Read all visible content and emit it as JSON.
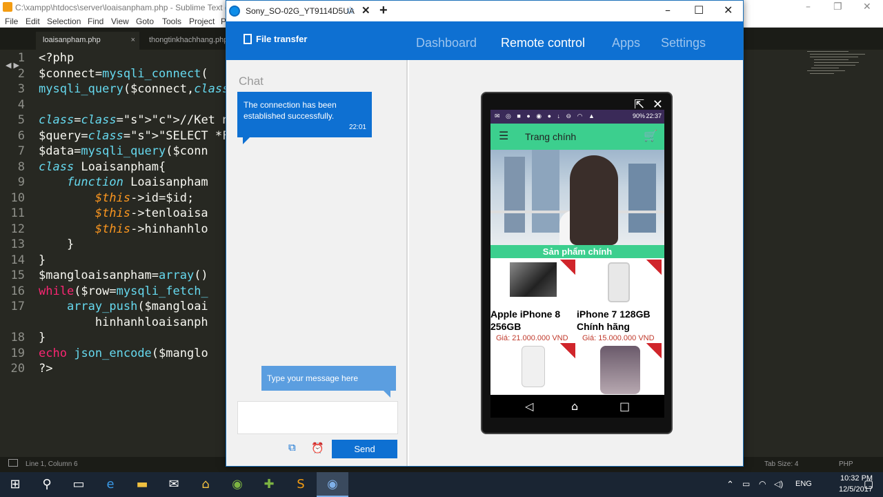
{
  "sublime": {
    "title": "C:\\xampp\\htdocs\\server\\loaisanpham.php - Sublime Text (UN",
    "menu": [
      "File",
      "Edit",
      "Selection",
      "Find",
      "View",
      "Goto",
      "Tools",
      "Project",
      "P"
    ],
    "tabs": [
      {
        "label": "loaisanpham.php",
        "close": "×"
      },
      {
        "label": "thongtinkhachhang.php"
      }
    ],
    "line_numbers": [
      "1",
      "2",
      "3",
      "4",
      "5",
      "6",
      "7",
      "8",
      "9",
      "10",
      "11",
      "12",
      "13",
      "14",
      "15",
      "16",
      "17",
      "",
      "18",
      "19",
      "20"
    ],
    "code": [
      "<?php",
      "$connect=mysqli_connect(",
      "mysqli_query($connect,\"S",
      "",
      "//Ket noi den bang du li",
      "$query=\"SELECT *FROM loa",
      "$data=mysqli_query($conn",
      "class Loaisanpham{",
      "    function Loaisanpham",
      "        $this->id=$id;",
      "        $this->tenloaisa",
      "        $this->hinhanhlo",
      "    }",
      "}",
      "$mangloaisanpham=array()",
      "while($row=mysqli_fetch_",
      "    array_push($mangloai",
      "        hinhanhloaisanph",
      "}",
      "echo json_encode($manglo",
      "?>"
    ],
    "status_left": "Line 1, Column 6",
    "status_tab": "Tab Size: 4",
    "status_syntax": "PHP"
  },
  "teamviewer": {
    "tab_title": "Sony_SO-02G_YT9114D5UA",
    "file_transfer": "File transfer",
    "nav": [
      "Dashboard",
      "Remote control",
      "Apps",
      "Settings"
    ],
    "active_nav": "Remote control",
    "chat": {
      "title": "Chat",
      "message": "The connection has been established successfully.",
      "time": "22:01",
      "placeholder": "Type your message here",
      "send": "Send"
    }
  },
  "phone": {
    "status": {
      "battery": "90%",
      "clock": "22:37"
    },
    "app_title": "Trang chính",
    "section": "Sản phẩm chính",
    "products": [
      {
        "name": "Apple iPhone 8 256GB",
        "price": "Giá: 21.000.000 VND"
      },
      {
        "name": "iPhone 7 128GB Chính hãng",
        "price": "Giá: 15.000.000 VND"
      }
    ]
  },
  "taskbar": {
    "time": "10:32 PM",
    "date": "12/5/2017",
    "lang": "ENG"
  }
}
